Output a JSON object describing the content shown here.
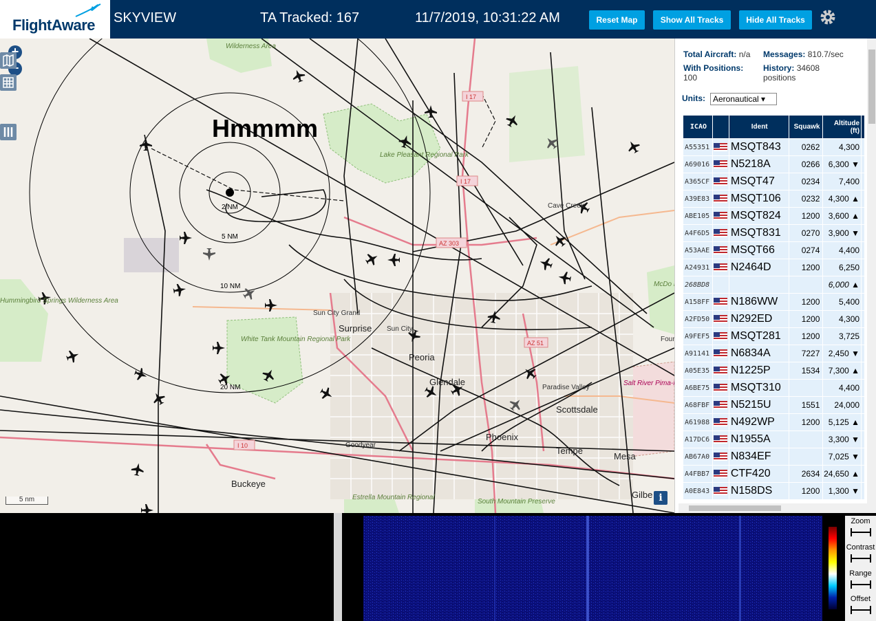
{
  "header": {
    "logo": "FlightAware",
    "title": "SKYVIEW",
    "tracked": "TA Tracked: 167",
    "datetime": "11/7/2019, 10:31:22 AM",
    "buttons": {
      "reset": "Reset Map",
      "show": "Show All Tracks",
      "hide": "Hide All Tracks"
    }
  },
  "map": {
    "annotation": "Hmmmm",
    "zoom_in": "+",
    "zoom_out": "−",
    "scale": "5 nm",
    "info": "i",
    "range_rings": [
      "2 NM",
      "5 NM",
      "10 NM",
      "20 NM"
    ],
    "labels": {
      "wilderness": "Wilderness Area",
      "lake_pleasant": "Lake Pleasant Regional Park",
      "i17a": "I 17",
      "i17b": "I 17",
      "cave_creek": "Cave Creek",
      "az303": "AZ 303",
      "sun_city_grand": "Sun City Grand",
      "surprise": "Surprise",
      "sun_city": "Sun City",
      "az51": "AZ 51",
      "hummingbird": "Hummingbird Springs Wilderness Area",
      "white_tank": "White Tank Mountain Regional Park",
      "peoria": "Peoria",
      "glendale": "Glendale",
      "paradise_valley": "Paradise Valley",
      "scottsdale": "Scottsdale",
      "salt_river": "Salt River Pima-Maricopa Indian Community",
      "i10": "I 10",
      "goodyear": "Goodyear",
      "phoenix": "Phoenix",
      "tempe": "Tempe",
      "mesa": "Mesa",
      "buckeye": "Buckeye",
      "estrella": "Estrella Mountain Regional",
      "south_mountain": "South Mountain Preserve",
      "gilbert": "Gilbe",
      "mcdowell": "McDo Moun Regio",
      "four": "Four"
    }
  },
  "sidebar": {
    "total_aircraft_label": "Total Aircraft:",
    "total_aircraft": "n/a",
    "messages_label": "Messages:",
    "messages": "810.7/sec",
    "with_positions_label": "With Positions:",
    "with_positions": "100",
    "history_label": "History:",
    "history": "34608 positions",
    "units_label": "Units:",
    "units_value": "Aeronautical ▾",
    "columns": [
      "ICAO",
      "",
      "Ident",
      "Squawk",
      "Altitude (ft)"
    ],
    "rows": [
      {
        "icao": "A55351",
        "ident": "MSQT843",
        "squawk": "0262",
        "alt": "4,300"
      },
      {
        "icao": "A69016",
        "ident": "N5218A",
        "squawk": "0266",
        "alt": "6,300 ▼"
      },
      {
        "icao": "A365CF",
        "ident": "MSQT47",
        "squawk": "0234",
        "alt": "7,400"
      },
      {
        "icao": "A39E83",
        "ident": "MSQT106",
        "squawk": "0232",
        "alt": "4,300 ▲"
      },
      {
        "icao": "ABE105",
        "ident": "MSQT824",
        "squawk": "1200",
        "alt": "3,600 ▲"
      },
      {
        "icao": "A4F6D5",
        "ident": "MSQT831",
        "squawk": "0270",
        "alt": "3,900 ▼"
      },
      {
        "icao": "A53AAE",
        "ident": "MSQT66",
        "squawk": "0274",
        "alt": "4,400"
      },
      {
        "icao": "A24931",
        "ident": "N2464D",
        "squawk": "1200",
        "alt": "6,250"
      },
      {
        "icao": "268BD8",
        "ident": "",
        "squawk": "",
        "alt": "6,000 ▲",
        "selected": true
      },
      {
        "icao": "A158FF",
        "ident": "N186WW",
        "squawk": "1200",
        "alt": "5,400"
      },
      {
        "icao": "A2FD50",
        "ident": "N292ED",
        "squawk": "1200",
        "alt": "4,300"
      },
      {
        "icao": "A9FEF5",
        "ident": "MSQT281",
        "squawk": "1200",
        "alt": "3,725"
      },
      {
        "icao": "A91141",
        "ident": "N6834A",
        "squawk": "7227",
        "alt": "2,450 ▼"
      },
      {
        "icao": "A05E35",
        "ident": "N1225P",
        "squawk": "1534",
        "alt": "7,300 ▲"
      },
      {
        "icao": "A6BE75",
        "ident": "MSQT310",
        "squawk": "",
        "alt": "4,400"
      },
      {
        "icao": "A68FBF",
        "ident": "N5215U",
        "squawk": "1551",
        "alt": "24,000"
      },
      {
        "icao": "A61988",
        "ident": "N492WP",
        "squawk": "1200",
        "alt": "5,125 ▲"
      },
      {
        "icao": "A17DC6",
        "ident": "N1955A",
        "squawk": "",
        "alt": "3,300 ▼"
      },
      {
        "icao": "AB67A0",
        "ident": "N834EF",
        "squawk": "",
        "alt": "7,025 ▼"
      },
      {
        "icao": "A4FBB7",
        "ident": "CTF420",
        "squawk": "2634",
        "alt": "24,650 ▲"
      },
      {
        "icao": "A0E843",
        "ident": "N158DS",
        "squawk": "1200",
        "alt": "1,300 ▼"
      }
    ]
  },
  "spectrum": {
    "controls": [
      "Zoom",
      "Contrast",
      "Range",
      "Offset"
    ]
  },
  "colors": {
    "header": "#002f5d",
    "accent": "#00a0e2",
    "map_bg": "#f2efe9"
  }
}
